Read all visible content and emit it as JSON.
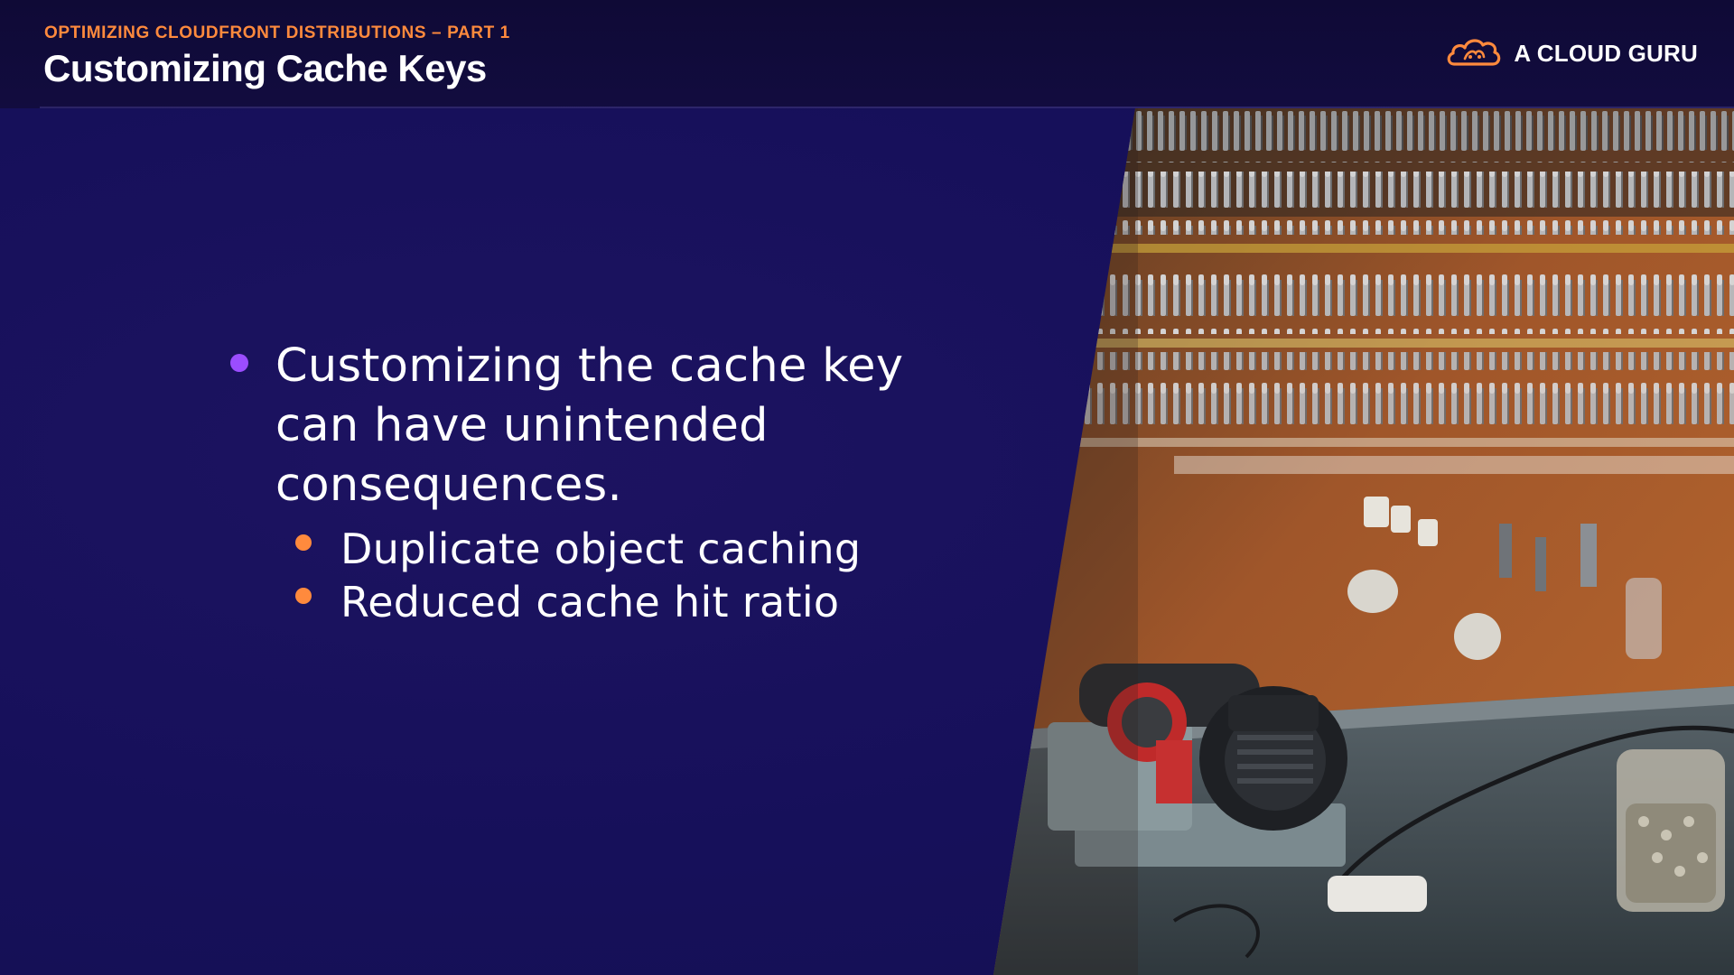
{
  "header": {
    "kicker": "OPTIMIZING CLOUDFRONT DISTRIBUTIONS – PART 1",
    "title": "Customizing Cache Keys"
  },
  "brand": {
    "name": "A CLOUD GURU",
    "icon": "cloud-logo-icon"
  },
  "bullets": {
    "main": "Customizing the cache key can have unintended consequences.",
    "sub": [
      "Duplicate object caching",
      "Reduced cache hit ratio"
    ]
  },
  "photo": {
    "subject": "key-cutting-workshop-image"
  },
  "colors": {
    "accent_orange": "#ff8a3d",
    "bullet_purple": "#9b4dff",
    "background": "#150e4a"
  }
}
